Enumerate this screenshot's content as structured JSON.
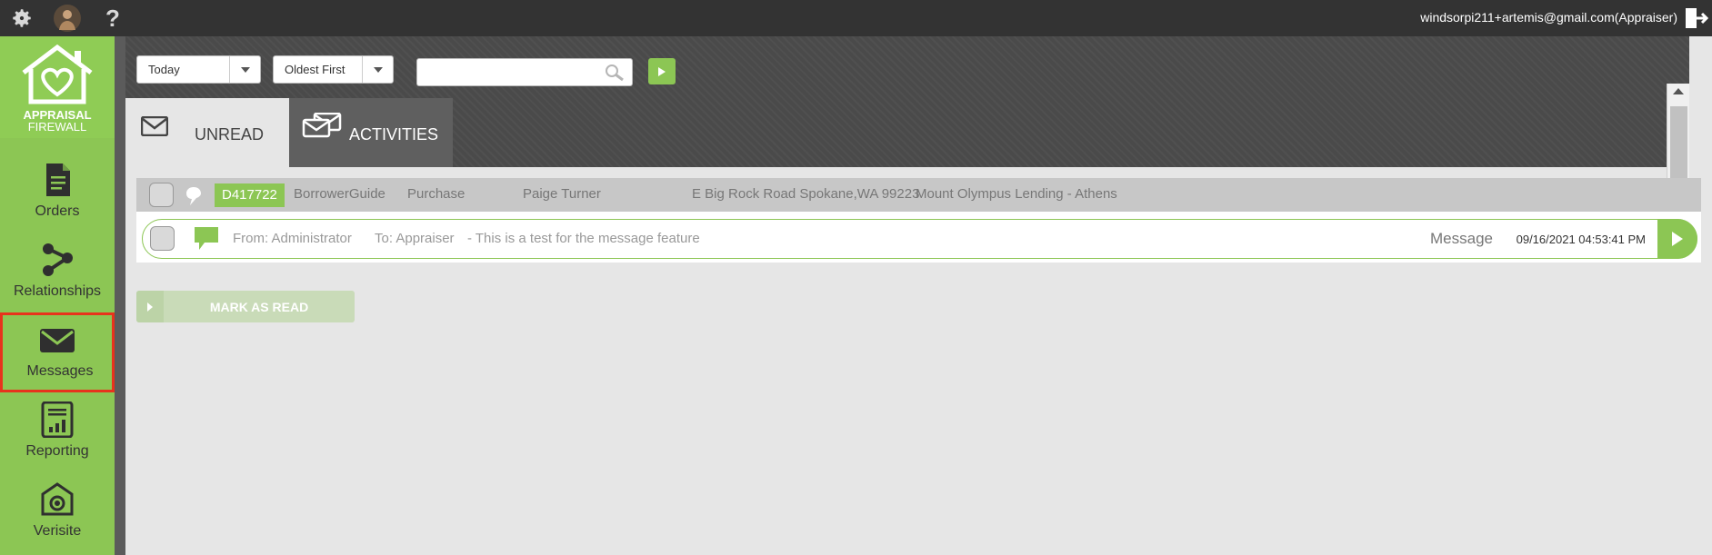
{
  "topbar": {
    "user_label": "windsorpi211+artemis@gmail.com(Appraiser)"
  },
  "logo": {
    "line1": "APPRAISAL",
    "line2": "FIREWALL"
  },
  "sidebar": {
    "items": [
      {
        "label": "Orders",
        "icon": "document-icon"
      },
      {
        "label": "Relationships",
        "icon": "relationships-icon"
      },
      {
        "label": "Messages",
        "icon": "envelope-icon",
        "active": true
      },
      {
        "label": "Reporting",
        "icon": "report-chart-icon"
      },
      {
        "label": "Verisite",
        "icon": "camera-icon"
      }
    ]
  },
  "filters": {
    "date_value": "Today",
    "sort_value": "Oldest First",
    "search_placeholder": ""
  },
  "tabs": [
    {
      "label": "UNREAD"
    },
    {
      "label": "ACTIVITIES"
    }
  ],
  "order": {
    "id": "D417722",
    "client": "BorrowerGuide",
    "type": "Purchase",
    "borrower": "Paige Turner",
    "address": "E Big Rock Road Spokane,WA 99223",
    "lender": "Mount Olympus Lending - Athens"
  },
  "message": {
    "from": "From: Administrator",
    "to": "To: Appraiser",
    "body": "- This is a test for the message feature",
    "type": "Message",
    "timestamp": "09/16/2021 04:53:41 PM"
  },
  "actions": {
    "mark_read_label": "MARK AS READ"
  },
  "colors": {
    "brand_green": "#8cc654",
    "active_outline": "#e8331c",
    "topbar": "#333333"
  }
}
